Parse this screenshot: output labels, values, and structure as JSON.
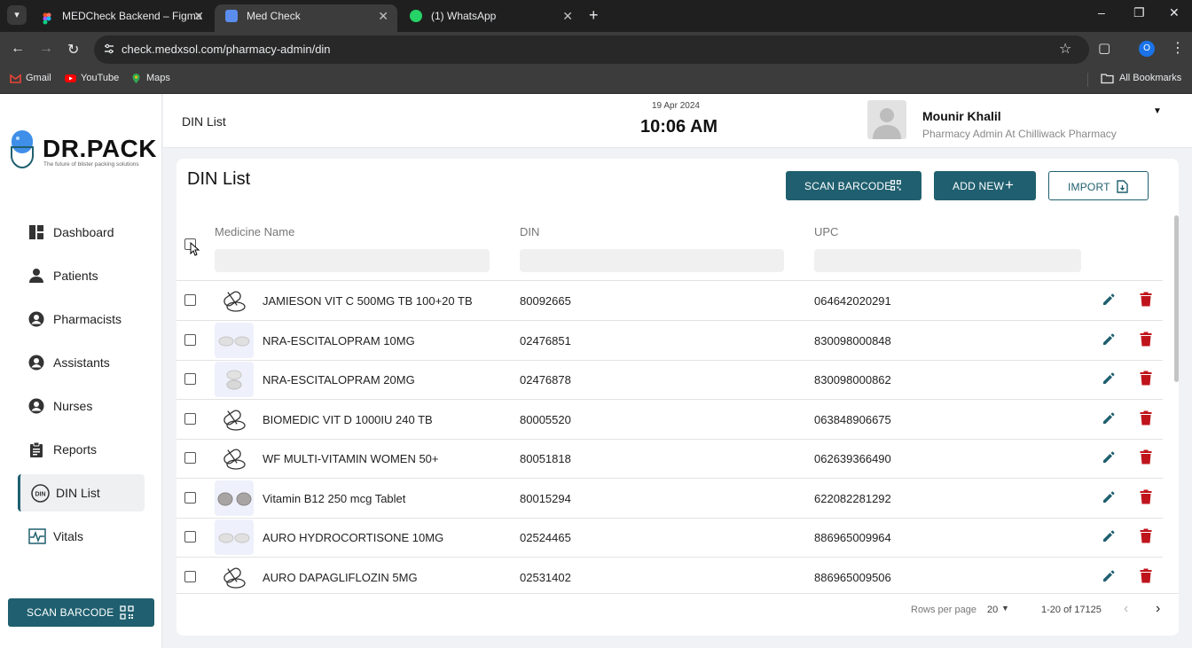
{
  "browser": {
    "tabs": [
      {
        "title": "MEDCheck Backend – Figma",
        "active": false
      },
      {
        "title": "Med Check",
        "active": true
      },
      {
        "title": "(1) WhatsApp",
        "active": false
      }
    ],
    "url": "check.medxsol.com/pharmacy-admin/din",
    "profile_initial": "O",
    "bookmarks": [
      "Gmail",
      "YouTube",
      "Maps"
    ],
    "all_bookmarks": "All Bookmarks"
  },
  "logo": {
    "name": "DR.PACK",
    "tagline": "The future of blister packing solutions"
  },
  "sidebar": {
    "items": [
      {
        "label": "Dashboard",
        "icon": "dashboard-icon"
      },
      {
        "label": "Patients",
        "icon": "person-icon"
      },
      {
        "label": "Pharmacists",
        "icon": "account-circle-icon"
      },
      {
        "label": "Assistants",
        "icon": "account-circle-icon"
      },
      {
        "label": "Nurses",
        "icon": "account-circle-icon"
      },
      {
        "label": "Reports",
        "icon": "clipboard-icon"
      },
      {
        "label": "DIN List",
        "icon": "din-icon",
        "active": true
      },
      {
        "label": "Vitals",
        "icon": "vitals-icon"
      }
    ],
    "scan_label": "SCAN BARCODE"
  },
  "header": {
    "title": "DIN List",
    "date": "19 Apr 2024",
    "time": "10:06 AM",
    "user_name": "Mounir Khalil",
    "user_role": "Pharmacy Admin At Chilliwack Pharmacy"
  },
  "card": {
    "title": "DIN List",
    "buttons": {
      "scan": "SCAN BARCODE",
      "add": "ADD NEW",
      "import": "IMPORT"
    },
    "columns": {
      "name": "Medicine Name",
      "din": "DIN",
      "upc": "UPC"
    }
  },
  "rows": [
    {
      "name": "JAMIESON VIT C 500MG TB 100+20 TB",
      "din": "80092665",
      "upc": "064642020291",
      "thumb": "capsule-outline"
    },
    {
      "name": "NRA-ESCITALOPRAM 10MG",
      "din": "02476851",
      "upc": "830098000848",
      "thumb": "white-tablets-pair"
    },
    {
      "name": "NRA-ESCITALOPRAM 20MG",
      "din": "02476878",
      "upc": "830098000862",
      "thumb": "white-tablets-stack"
    },
    {
      "name": "BIOMEDIC VIT D 1000IU 240 TB",
      "din": "80005520",
      "upc": "063848906675",
      "thumb": "capsule-outline"
    },
    {
      "name": "WF MULTI-VITAMIN WOMEN 50+",
      "din": "80051818",
      "upc": "062639366490",
      "thumb": "capsule-outline"
    },
    {
      "name": "Vitamin B12 250 mcg Tablet",
      "din": "80015294",
      "upc": "622082281292",
      "thumb": "grey-tablets-pair"
    },
    {
      "name": "AURO HYDROCORTISONE 10MG",
      "din": "02524465",
      "upc": "886965009964",
      "thumb": "white-tablets-pair"
    },
    {
      "name": "AURO DAPAGLIFLOZIN 5MG",
      "din": "02531402",
      "upc": "886965009506",
      "thumb": "capsule-outline"
    }
  ],
  "pagination": {
    "rows_per_page_label": "Rows per page",
    "rows_per_page": "20",
    "range": "1-20 of 17125"
  },
  "colors": {
    "primary": "#1f5f6f",
    "delete": "#c0141c",
    "tinted_thumb": "#eef0fb"
  }
}
